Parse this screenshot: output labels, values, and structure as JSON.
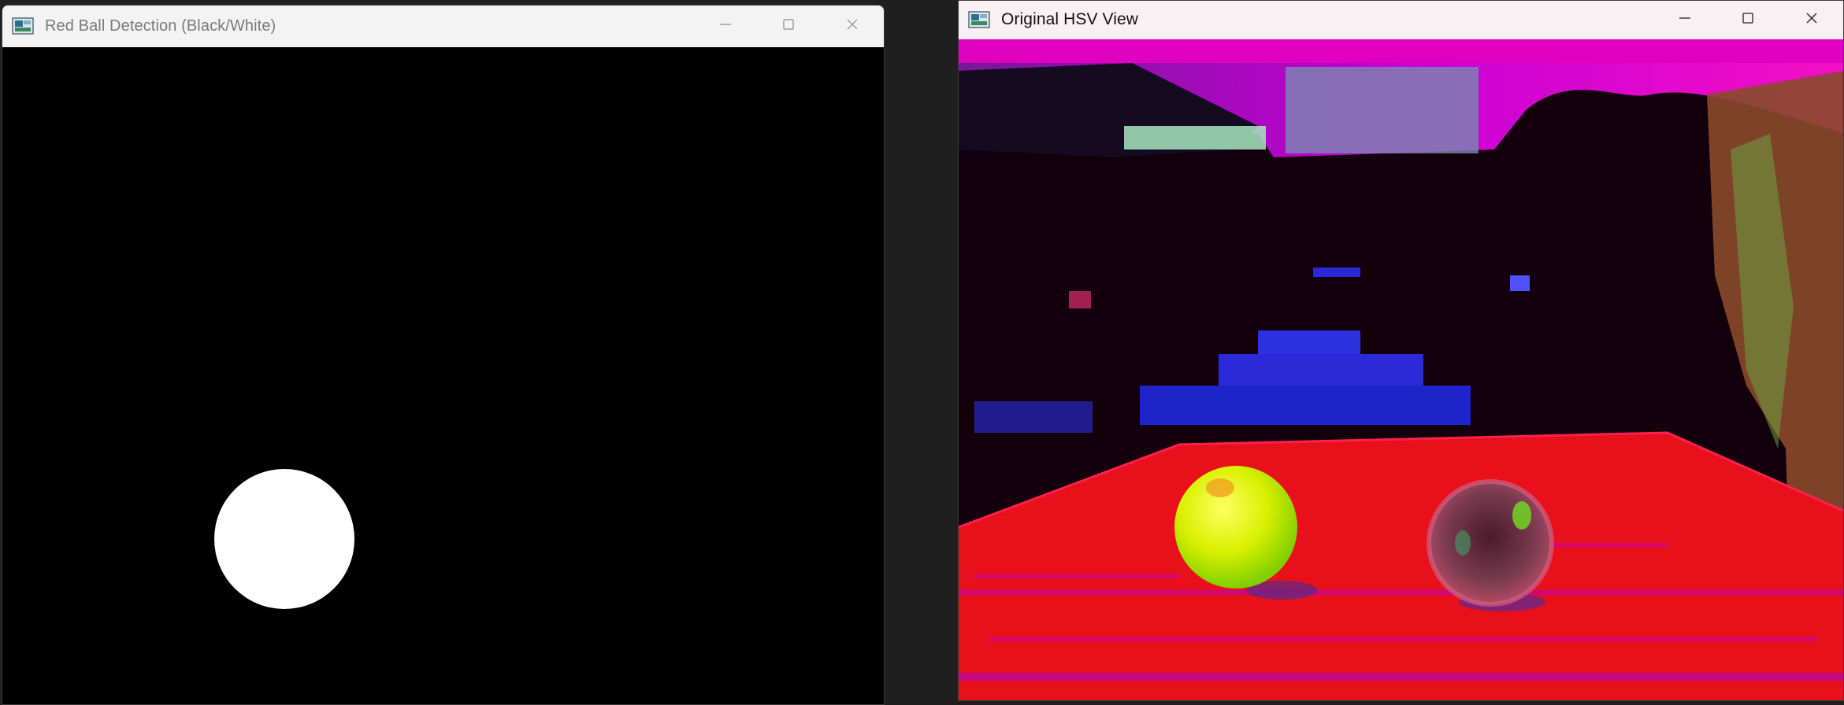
{
  "windows": {
    "left": {
      "title": "Red Ball Detection (Black/White)",
      "caption_buttons": [
        "minimize-icon",
        "maximize-icon",
        "close-icon"
      ],
      "content": {
        "background": "#000000",
        "detected_ball_color": "#ffffff"
      }
    },
    "right": {
      "title": "Original HSV View",
      "caption_buttons": [
        "minimize-icon",
        "maximize-icon",
        "close-icon"
      ],
      "content": {
        "table_color": "#e8101a",
        "wall_color": "#ff00ff",
        "dark_color": "#1a000d"
      }
    }
  }
}
